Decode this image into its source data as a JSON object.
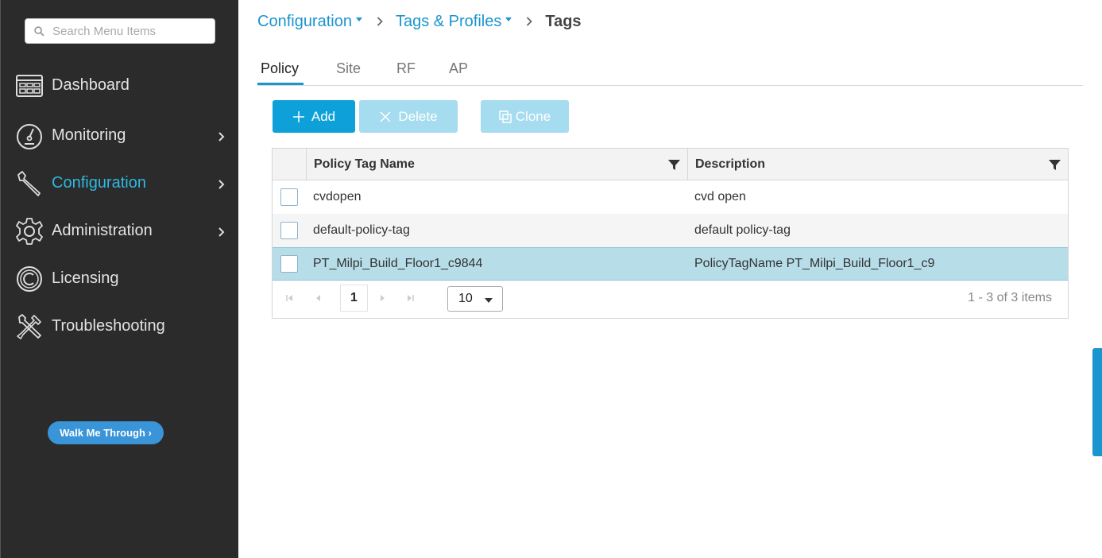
{
  "search": {
    "placeholder": "Search Menu Items"
  },
  "sidebar": {
    "items": [
      {
        "label": "Dashboard",
        "icon": "dashboard-icon",
        "has_submenu": false
      },
      {
        "label": "Monitoring",
        "icon": "gauge-icon",
        "has_submenu": true
      },
      {
        "label": "Configuration",
        "icon": "wrench-icon",
        "has_submenu": true,
        "active": true
      },
      {
        "label": "Administration",
        "icon": "gear-icon",
        "has_submenu": true
      },
      {
        "label": "Licensing",
        "icon": "licensing-icon",
        "has_submenu": false
      },
      {
        "label": "Troubleshooting",
        "icon": "tools-icon",
        "has_submenu": false
      }
    ],
    "walk_me_through": "Walk Me Through ›"
  },
  "breadcrumb": {
    "items": [
      {
        "label": "Configuration",
        "dropdown": true
      },
      {
        "label": "Tags & Profiles",
        "dropdown": true
      }
    ],
    "current": "Tags"
  },
  "tabs": [
    {
      "label": "Policy",
      "active": true
    },
    {
      "label": "Site"
    },
    {
      "label": "RF"
    },
    {
      "label": "AP"
    }
  ],
  "toolbar": {
    "add_label": "Add",
    "delete_label": "Delete",
    "clone_label": "Clone"
  },
  "table": {
    "columns": [
      "Policy Tag Name",
      "Description"
    ],
    "rows": [
      {
        "name": "cvdopen",
        "description": "cvd open",
        "selected": false
      },
      {
        "name": "default-policy-tag",
        "description": "default policy-tag",
        "selected": false
      },
      {
        "name": "PT_Milpi_Build_Floor1_c9844",
        "description": "PolicyTagName PT_Milpi_Build_Floor1_c9",
        "selected": true
      }
    ]
  },
  "pager": {
    "current_page": "1",
    "page_size": "10",
    "info": "1 - 3 of 3 items"
  },
  "colors": {
    "accent": "#1a95cf",
    "sidebar_bg": "#2b2b2b",
    "selected_row": "#b7dde8",
    "add_button": "#0da0d9",
    "disabled_button": "#a6dcef"
  }
}
